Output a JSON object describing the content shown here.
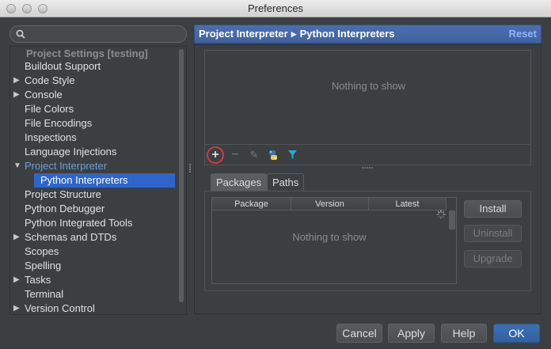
{
  "window": {
    "title": "Preferences"
  },
  "sidebar": {
    "search": {
      "placeholder": "",
      "value": ""
    },
    "section_title": "Project Settings [testing]",
    "items": [
      {
        "label": "Buildout Support",
        "arrow": ""
      },
      {
        "label": "Code Style",
        "arrow": "▶"
      },
      {
        "label": "Console",
        "arrow": "▶"
      },
      {
        "label": "File Colors",
        "arrow": ""
      },
      {
        "label": "File Encodings",
        "arrow": ""
      },
      {
        "label": "Inspections",
        "arrow": ""
      },
      {
        "label": "Language Injections",
        "arrow": ""
      },
      {
        "label": "Project Interpreter",
        "arrow": "▼"
      },
      {
        "label": "Python Interpreters",
        "arrow": ""
      },
      {
        "label": "Project Structure",
        "arrow": ""
      },
      {
        "label": "Python Debugger",
        "arrow": ""
      },
      {
        "label": "Python Integrated Tools",
        "arrow": ""
      },
      {
        "label": "Schemas and DTDs",
        "arrow": "▶"
      },
      {
        "label": "Scopes",
        "arrow": ""
      },
      {
        "label": "Spelling",
        "arrow": ""
      },
      {
        "label": "Tasks",
        "arrow": "▶"
      },
      {
        "label": "Terminal",
        "arrow": ""
      },
      {
        "label": "Version Control",
        "arrow": "▶"
      }
    ]
  },
  "header": {
    "breadcrumb_parent": "Project Interpreter",
    "breadcrumb_child": "Python Interpreters",
    "reset_label": "Reset"
  },
  "interpreters": {
    "empty_text": "Nothing to show",
    "toolbar": {
      "add": "+",
      "remove": "−",
      "edit": "✎"
    }
  },
  "tabs": {
    "packages": "Packages",
    "paths": "Paths"
  },
  "packages": {
    "columns": [
      "Package",
      "Version",
      "Latest"
    ],
    "empty_text": "Nothing to show",
    "install_label": "Install",
    "uninstall_label": "Uninstall",
    "upgrade_label": "Upgrade"
  },
  "footer": {
    "cancel": "Cancel",
    "apply": "Apply",
    "help": "Help",
    "ok": "OK"
  },
  "colors": {
    "accent": "#2f65ca",
    "header": "#4b6eaf",
    "highlight_ring": "#d83838"
  }
}
